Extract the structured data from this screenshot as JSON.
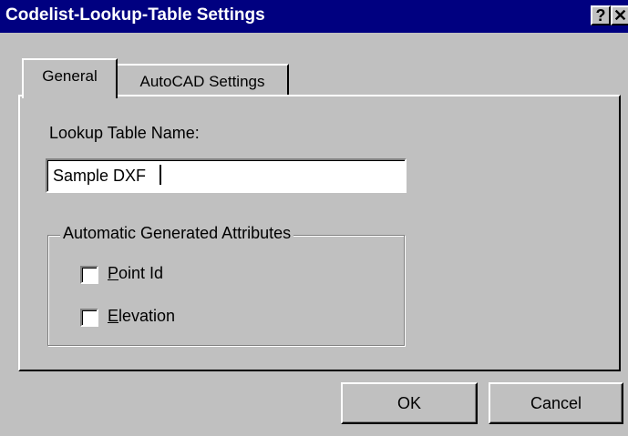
{
  "window": {
    "title": "Codelist-Lookup-Table Settings",
    "help_icon": "?",
    "close_icon": "✕"
  },
  "tabs": [
    {
      "label": "General",
      "selected": true
    },
    {
      "label": "AutoCAD Settings",
      "selected": false
    }
  ],
  "general": {
    "lookup_label": "Lookup Table Name:",
    "lookup_value": "Sample DXF",
    "group_title": "Automatic Generated Attributes",
    "checkboxes": [
      {
        "label_mnemonic": "P",
        "label_rest": "oint Id",
        "checked": false
      },
      {
        "label_mnemonic": "E",
        "label_rest": "levation",
        "checked": false
      }
    ]
  },
  "buttons": {
    "ok": "OK",
    "cancel": "Cancel"
  },
  "colors": {
    "titlebar": "#000080",
    "face": "#c0c0c0"
  }
}
